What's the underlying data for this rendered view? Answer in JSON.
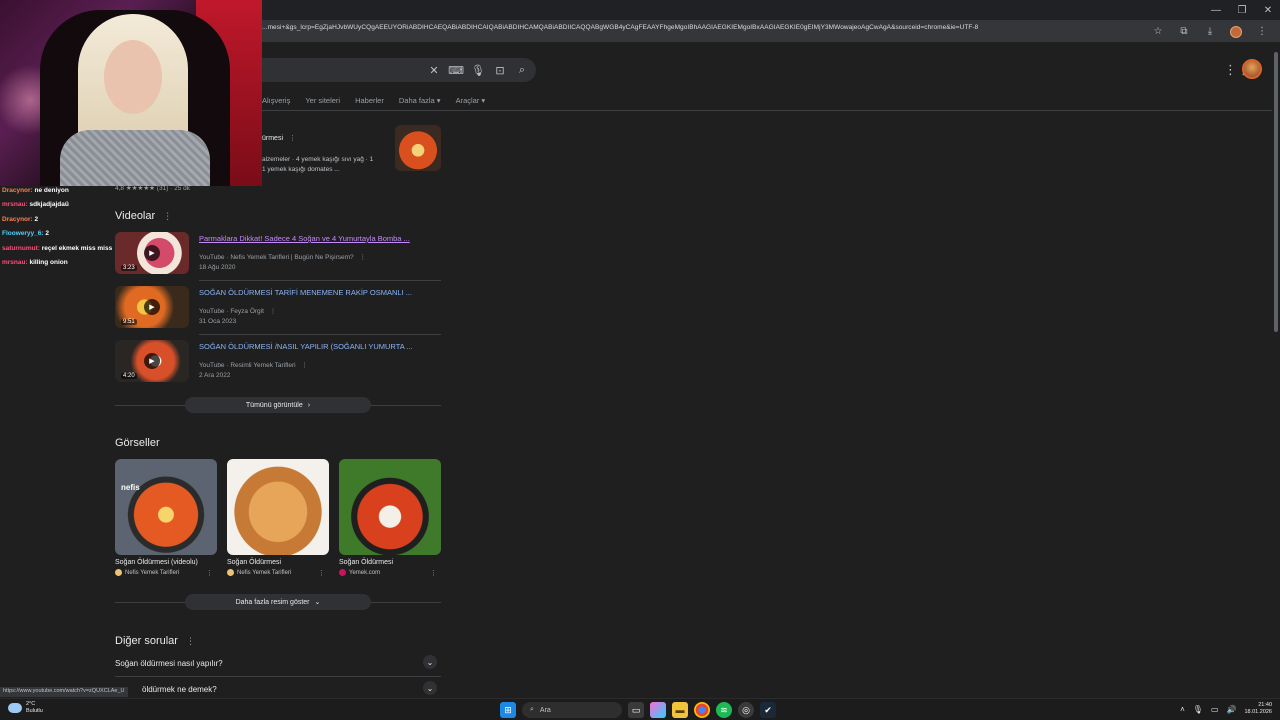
{
  "browser": {
    "url": "...mesi+&gs_lcrp=EgZjaHJvbWUyCQgAEEUYORiABDIHCAEQABiABDIHCAIQABiABDIHCAMQABiABDIICAQQABgWGB4yCAgFEAAYFhgeMgoIBhAAGIAEGKIEMgoIBxAAGIAEGKIE0gEIMjY3MWowajeoAgCwAgA&sourceid=chrome&ie=UTF-8",
    "status_url": "https://www.youtube.com/watch?v=zQUXCLAe_U"
  },
  "tabs": [
    "Alışveriş",
    "Yer siteleri",
    "Haberler",
    "Daha fazla",
    "Araçlar"
  ],
  "recipe": {
    "menu": "ürmesi",
    "line1": "alzemeler · 4 yemek kaşığı sıvı yağ · 1",
    "line2": "1 yemek kaşığı domates ...",
    "rating": "4,8 ★★★★★ (31) · 25 dk"
  },
  "videos": {
    "title": "Videolar",
    "items": [
      {
        "title": "Parmaklara Dikkat! Sadece 4 Soğan ve 4 Yumurtayla Bomba ...",
        "source": "YouTube · Nefis Yemek Tarifleri | Bugün Ne Pişirsem?",
        "date": "18 Ağu 2020",
        "duration": "3:23"
      },
      {
        "title": "SOĞAN ÖLDÜRMESİ TARİFİ MENEMENE RAKİP OSMANLI ...",
        "source": "YouTube · Feyza Örgit",
        "date": "31 Oca 2023",
        "duration": "9:51"
      },
      {
        "title": "SOĞAN ÖLDÜRMESİ /NASIL YAPILIR (SOĞANLI YUMURTA ...",
        "source": "YouTube · Resimli Yemek Tarifleri",
        "date": "2 Ara 2022",
        "duration": "4:20"
      }
    ],
    "view_all": "Tümünü görüntüle"
  },
  "images": {
    "title": "Görseller",
    "items": [
      {
        "caption": "Soğan Öldürmesi (videolu)",
        "source": "Nefis Yemek Tarifleri"
      },
      {
        "caption": "Soğan Öldürmesi",
        "source": "Nefis Yemek Tarifleri"
      },
      {
        "caption": "Soğan Öldürmesi",
        "source": "Yemek.com"
      }
    ],
    "more": "Daha fazla resim göster"
  },
  "questions": {
    "title": "Diğer sorular",
    "items": [
      "Soğan öldürmesi nasıl yapılır?",
      "öldürmek ne demek?"
    ]
  },
  "chat": [
    {
      "user": "Dracynor:",
      "msg": "ne deniyon",
      "color": "#ff7f50"
    },
    {
      "user": "mrsnau:",
      "msg": "sdkjadjajdaü",
      "color": "#ff4f7a"
    },
    {
      "user": "Dracynor:",
      "msg": "2",
      "color": "#ff7f50"
    },
    {
      "user": "Flooweryy_6:",
      "msg": "2",
      "color": "#4fd1ff"
    },
    {
      "user": "saturnumut:",
      "msg": "reçel ekmek miss miss",
      "color": "#ff4f7a"
    },
    {
      "user": "mrsnau:",
      "msg": "killing onion",
      "color": "#ff4f7a"
    }
  ],
  "taskbar": {
    "temp": "2°C",
    "weather": "Bulutlu",
    "search": "Ara",
    "time": "21:40",
    "date": "18.01.2026"
  }
}
